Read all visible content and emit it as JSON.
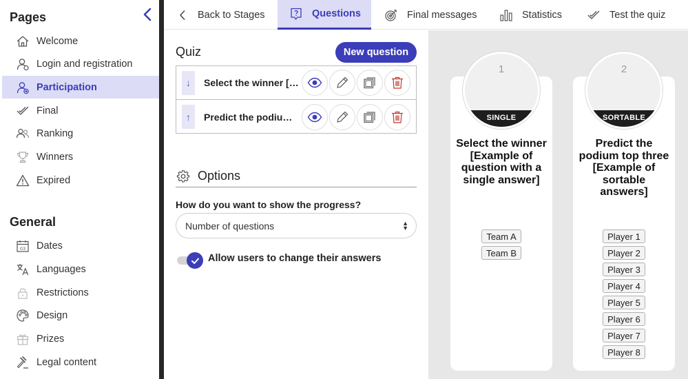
{
  "sidebar": {
    "pages_title": "Pages",
    "pages": [
      {
        "label": "Welcome",
        "icon": "home-icon"
      },
      {
        "label": "Login and registration",
        "icon": "user-icon"
      },
      {
        "label": "Participation",
        "icon": "user-plus-icon",
        "active": true
      },
      {
        "label": "Final",
        "icon": "check-icon"
      },
      {
        "label": "Ranking",
        "icon": "ranking-icon"
      },
      {
        "label": "Winners",
        "icon": "trophy-icon"
      },
      {
        "label": "Expired",
        "icon": "warning-icon"
      }
    ],
    "general_title": "General",
    "general": [
      {
        "label": "Dates",
        "icon": "calendar-icon"
      },
      {
        "label": "Languages",
        "icon": "translate-icon"
      },
      {
        "label": "Restrictions",
        "icon": "lock-icon"
      },
      {
        "label": "Design",
        "icon": "palette-icon"
      },
      {
        "label": "Prizes",
        "icon": "gift-icon"
      },
      {
        "label": "Legal content",
        "icon": "gavel-icon"
      }
    ]
  },
  "tabs": [
    {
      "label": "Back to Stages",
      "icon": "chevron-left-icon"
    },
    {
      "label": "Questions",
      "icon": "question-icon",
      "active": true
    },
    {
      "label": "Final messages",
      "icon": "target-icon"
    },
    {
      "label": "Statistics",
      "icon": "bar-chart-icon"
    },
    {
      "label": "Test the quiz",
      "icon": "check-icon"
    }
  ],
  "editor": {
    "quiz_title": "Quiz",
    "new_question_label": "New question",
    "questions": [
      {
        "text": "Select the winner [Example of question with a single answer]",
        "handle": "↓"
      },
      {
        "text": "Predict the podium top three [Example of sortable answers]",
        "handle": "↑"
      }
    ],
    "options_title": "Options",
    "progress_label": "How do you want to show the progress?",
    "progress_value": "Number of questions",
    "toggle_label": "Allow users to change their answers",
    "toggle_on": true
  },
  "preview": {
    "cards": [
      {
        "number": "1",
        "type": "SINGLE",
        "title": "Select the winner [Example of question with a single answer]",
        "answers": [
          "Team A",
          "Team B"
        ]
      },
      {
        "number": "2",
        "type": "SORTABLE",
        "title": "Predict the podium top three [Example of sortable answers]",
        "answers": [
          "Player 1",
          "Player 2",
          "Player 3",
          "Player 4",
          "Player 5",
          "Player 6",
          "Player 7",
          "Player 8"
        ]
      }
    ]
  },
  "colors": {
    "accent": "#3c3db8",
    "active_bg": "#dcdcf6",
    "delete": "#c0392b",
    "preview_bg": "#e7e7e7"
  }
}
